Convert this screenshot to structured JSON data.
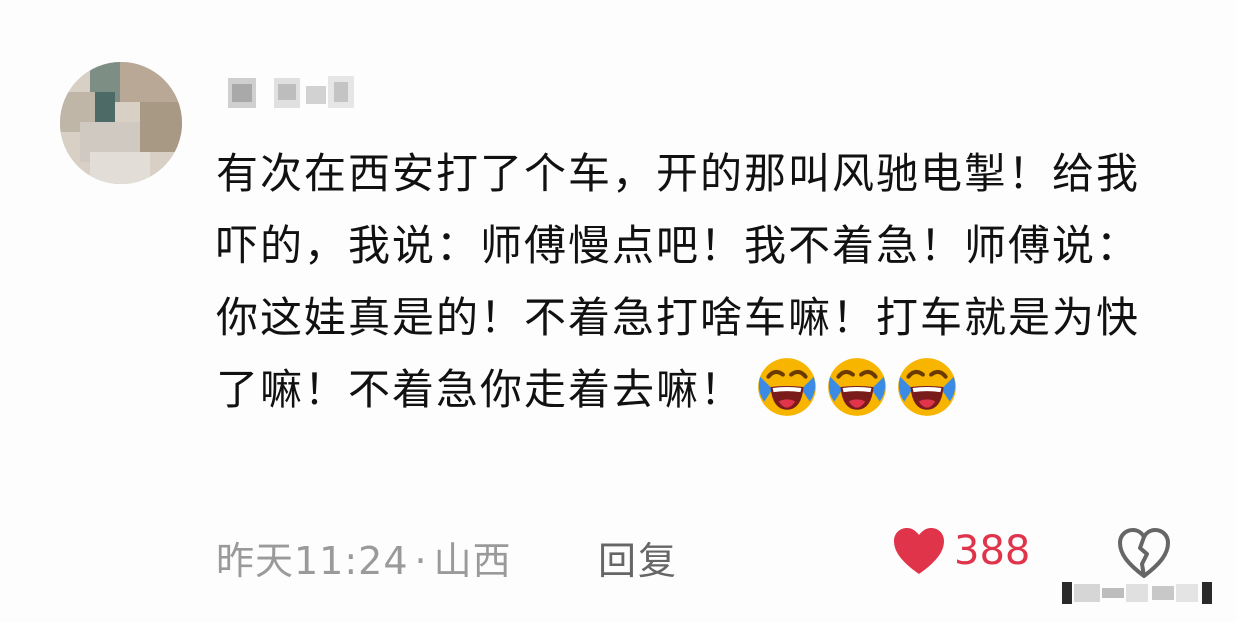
{
  "comment": {
    "text": "有次在西安打了个车，开的那叫风驰电掣！给我吓的，我说：师傅慢点吧！我不着急！师傅说：你这娃真是的！不着急打啥车嘛！打车就是为快了嘛！不着急你走着去嘛！",
    "emojis": [
      "laughing-crying-icon",
      "laughing-crying-icon",
      "laughing-crying-icon"
    ],
    "timestamp": "昨天11:24",
    "separator": "·",
    "location": "山西",
    "reply_label": "回复",
    "like_count": "388"
  },
  "colors": {
    "text": "#111111",
    "meta": "#9a9a9a",
    "like": "#e0344a",
    "emoji_face": "#f7b500",
    "emoji_tear": "#3b8be5"
  }
}
